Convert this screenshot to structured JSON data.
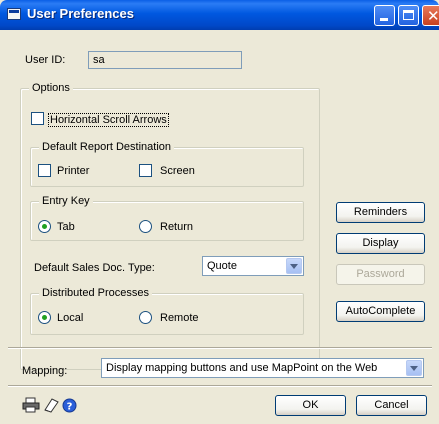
{
  "window": {
    "title": "User Preferences",
    "minimize_icon": "minimize-icon",
    "maximize_icon": "maximize-icon",
    "close_icon": "close-icon"
  },
  "user": {
    "label": "User ID:",
    "value": "sa"
  },
  "options": {
    "legend": "Options",
    "horizontal_scroll_arrows": {
      "label": "Horizontal Scroll Arrows",
      "checked": false
    },
    "report_destination": {
      "legend": "Default Report Destination",
      "printer": {
        "label": "Printer",
        "checked": false
      },
      "screen": {
        "label": "Screen",
        "checked": false
      }
    },
    "entry_key": {
      "legend": "Entry Key",
      "tab": {
        "label": "Tab",
        "checked": true
      },
      "return": {
        "label": "Return",
        "checked": false
      }
    },
    "sales_doc_type": {
      "label": "Default Sales Doc. Type:",
      "value": "Quote"
    },
    "distributed": {
      "legend": "Distributed Processes",
      "local": {
        "label": "Local",
        "checked": true
      },
      "remote": {
        "label": "Remote",
        "checked": false
      }
    }
  },
  "side_buttons": {
    "reminders": "Reminders",
    "display": "Display",
    "password": "Password",
    "autocomplete": "AutoComplete"
  },
  "mapping": {
    "label": "Mapping:",
    "value": "Display mapping buttons and use MapPoint on the Web"
  },
  "footer": {
    "ok": "OK",
    "cancel": "Cancel",
    "icons": [
      "printer-icon",
      "note-icon",
      "help-icon"
    ]
  }
}
